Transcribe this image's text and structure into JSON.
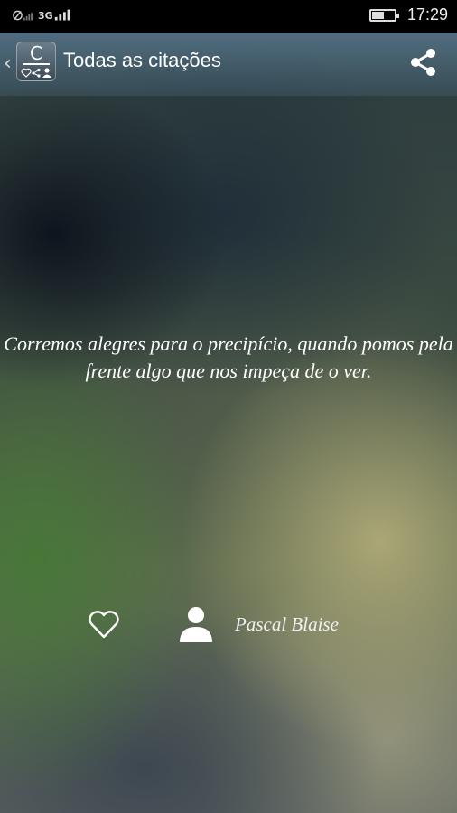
{
  "status_bar": {
    "network_label": "3G",
    "time": "17:29",
    "battery_level": 0.5
  },
  "app_bar": {
    "back_glyph": "‹",
    "logo_letter": "C",
    "title": "Todas as citações",
    "share_icon": "share-icon"
  },
  "quote": {
    "text": "Corremos alegres para o precipício, quando pomos pela frente algo que nos impeça de o ver."
  },
  "footer": {
    "favorite_icon": "heart-icon",
    "author_icon": "person-icon",
    "author": "Pascal Blaise"
  }
}
